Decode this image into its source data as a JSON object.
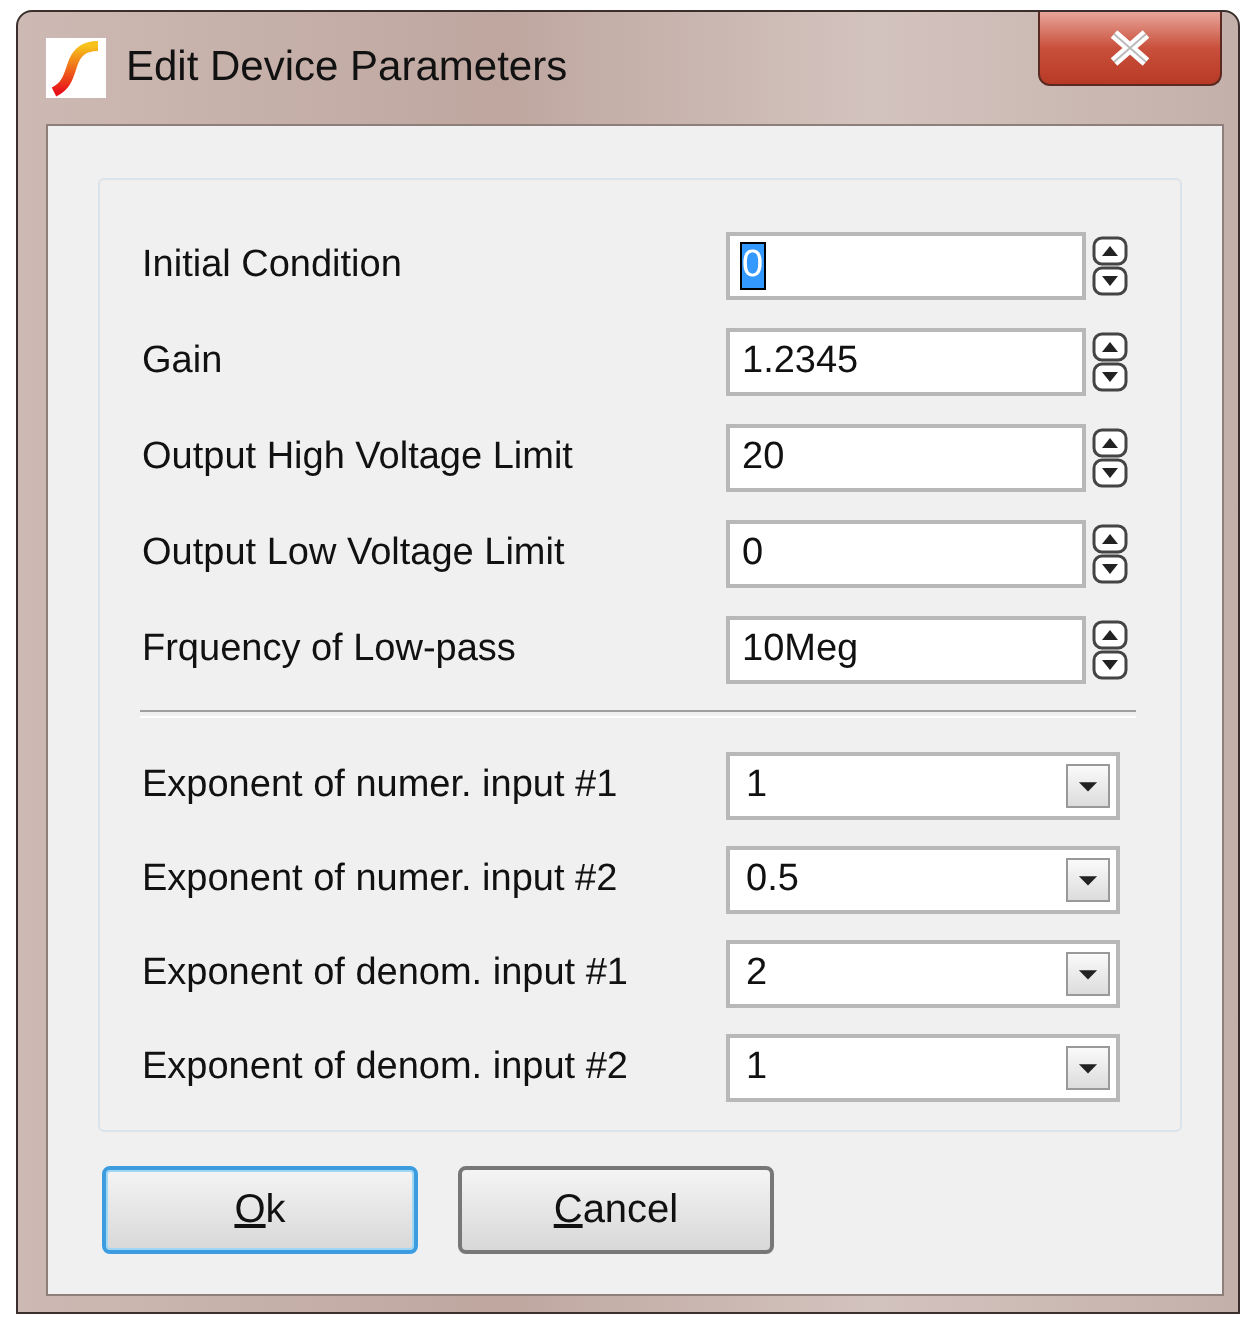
{
  "window": {
    "title": "Edit Device Parameters"
  },
  "parameters": [
    {
      "kind": "spin",
      "label": "Initial Condition",
      "value": "0",
      "selected": true
    },
    {
      "kind": "spin",
      "label": "Gain",
      "value": "1.2345",
      "selected": false
    },
    {
      "kind": "spin",
      "label": "Output High Voltage Limit",
      "value": "20",
      "selected": false
    },
    {
      "kind": "spin",
      "label": "Output Low Voltage Limit",
      "value": "0",
      "selected": false
    },
    {
      "kind": "spin",
      "label": "Frquency of Low-pass",
      "value": "10Meg",
      "selected": false
    },
    {
      "kind": "separator"
    },
    {
      "kind": "combo",
      "label": "Exponent of numer. input #1",
      "value": "1"
    },
    {
      "kind": "combo",
      "label": "Exponent of numer. input #2",
      "value": "0.5"
    },
    {
      "kind": "combo",
      "label": "Exponent of denom. input #1",
      "value": "2"
    },
    {
      "kind": "combo",
      "label": "Exponent of denom. input #2",
      "value": "1"
    }
  ],
  "buttons": [
    {
      "label": "Ok",
      "default": true,
      "mnemonic": true
    },
    {
      "label": "Cancel",
      "default": false,
      "mnemonic": true
    }
  ]
}
